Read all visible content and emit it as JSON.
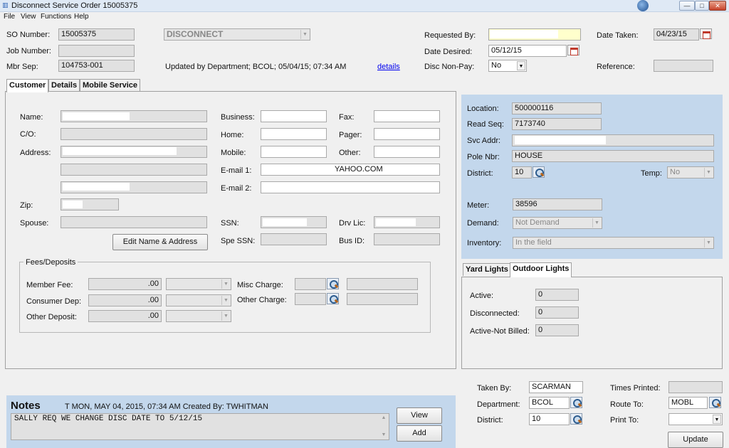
{
  "window": {
    "title": "Disconnect Service Order 15005375"
  },
  "menu": [
    "File",
    "View",
    "Functions",
    "Help"
  ],
  "header": {
    "so_number_label": "SO Number:",
    "so_number": "15005375",
    "job_number_label": "Job Number:",
    "job_number": "",
    "mbr_sep_label": "Mbr Sep:",
    "mbr_sep": "104753-001",
    "order_type": "DISCONNECT",
    "updated_text": "Updated by Department; BCOL; 05/04/15; 07:34 AM",
    "details_link": "details",
    "requested_by_label": "Requested By:",
    "requested_by": "",
    "date_desired_label": "Date Desired:",
    "date_desired": "05/12/15",
    "disc_non_pay_label": "Disc Non-Pay:",
    "disc_non_pay": "No",
    "date_taken_label": "Date Taken:",
    "date_taken": "04/23/15",
    "reference_label": "Reference:",
    "reference": ""
  },
  "tabs": [
    {
      "label": "Customer",
      "active": true
    },
    {
      "label": "Details",
      "active": false
    },
    {
      "label": "Mobile Service",
      "active": false
    }
  ],
  "customer": {
    "name_label": "Name:",
    "co_label": "C/O:",
    "address_label": "Address:",
    "zip_label": "Zip:",
    "spouse_label": "Spouse:",
    "business_label": "Business:",
    "home_label": "Home:",
    "mobile_label": "Mobile:",
    "email1_label": "E-mail 1:",
    "email1": "YAHOO.COM",
    "email2_label": "E-mail 2:",
    "fax_label": "Fax:",
    "pager_label": "Pager:",
    "other_label": "Other:",
    "ssn_label": "SSN:",
    "spe_ssn_label": "Spe SSN:",
    "drv_lic_label": "Drv Lic:",
    "bus_id_label": "Bus ID:",
    "edit_button": "Edit Name & Address"
  },
  "fees": {
    "legend": "Fees/Deposits",
    "member_fee_label": "Member Fee:",
    "member_fee": ".00",
    "consumer_dep_label": "Consumer Dep:",
    "consumer_dep": ".00",
    "other_deposit_label": "Other Deposit:",
    "other_deposit": ".00",
    "misc_charge_label": "Misc Charge:",
    "other_charge_label": "Other Charge:"
  },
  "service": {
    "location_label": "Location:",
    "location": "500000116",
    "read_seq_label": "Read Seq:",
    "read_seq": "7173740",
    "svc_addr_label": "Svc Addr:",
    "pole_nbr_label": "Pole Nbr:",
    "pole_nbr": "HOUSE",
    "district_label": "District:",
    "district": "10",
    "temp_label": "Temp:",
    "temp": "No",
    "meter_label": "Meter:",
    "meter": "38596",
    "demand_label": "Demand:",
    "demand": "Not Demand",
    "inventory_label": "Inventory:",
    "inventory": "In the field"
  },
  "lights": {
    "tabs": [
      {
        "label": "Yard Lights",
        "active": false
      },
      {
        "label": "Outdoor Lights",
        "active": true
      }
    ],
    "active_label": "Active:",
    "active": "0",
    "disconnected_label": "Disconnected:",
    "disconnected": "0",
    "active_not_billed_label": "Active-Not Billed:",
    "active_not_billed": "0"
  },
  "notes": {
    "title": "Notes",
    "meta": "T  MON, MAY 04, 2015, 07:34 AM  Created By: TWHITMAN",
    "text": "SALLY REQ WE CHANGE DISC DATE TO 5/12/15",
    "view_button": "View",
    "add_button": "Add"
  },
  "footer": {
    "taken_by_label": "Taken By:",
    "taken_by": "SCARMAN",
    "department_label": "Department:",
    "department": "BCOL",
    "district_label": "District:",
    "district": "10",
    "times_printed_label": "Times Printed:",
    "times_printed": "",
    "route_to_label": "Route To:",
    "route_to": "MOBL",
    "print_to_label": "Print To:",
    "print_to": "",
    "update_button": "Update"
  }
}
